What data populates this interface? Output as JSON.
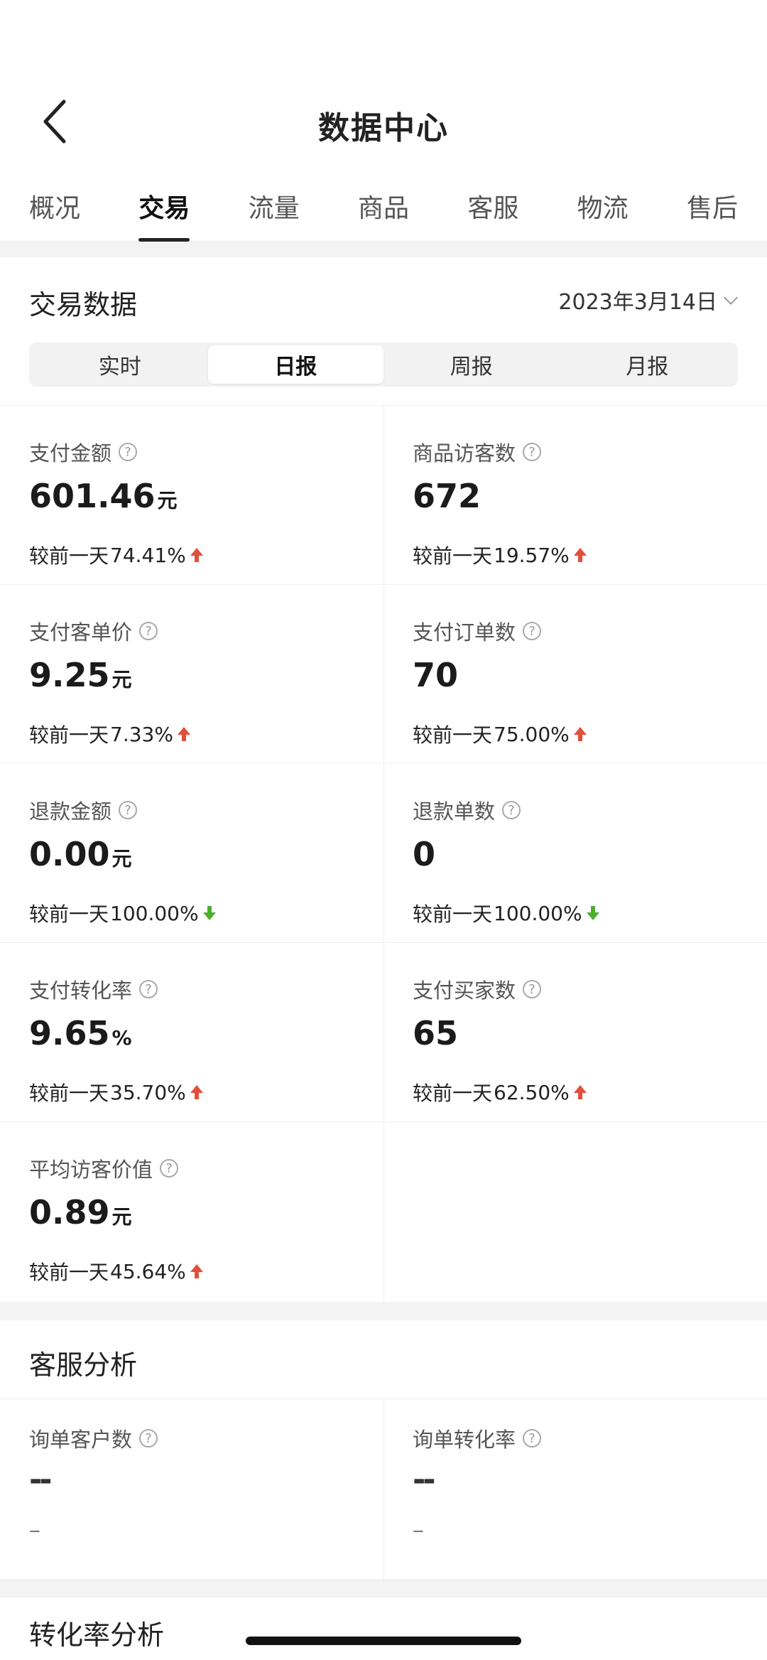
{
  "header": {
    "title": "数据中心"
  },
  "tabs": [
    "概况",
    "交易",
    "流量",
    "商品",
    "客服",
    "物流",
    "售后"
  ],
  "active_tab": "交易",
  "trade": {
    "title": "交易数据",
    "date": "2023年3月14日",
    "segments": [
      "实时",
      "日报",
      "周报",
      "月报"
    ],
    "active_segment": "日报",
    "metrics": [
      {
        "label": "支付金额",
        "value": "601.46",
        "unit": "元",
        "compare_prefix": "较前一天",
        "change": "74.41%",
        "trend": "up"
      },
      {
        "label": "商品访客数",
        "value": "672",
        "unit": "",
        "compare_prefix": "较前一天",
        "change": "19.57%",
        "trend": "up"
      },
      {
        "label": "支付客单价",
        "value": "9.25",
        "unit": "元",
        "compare_prefix": "较前一天",
        "change": "7.33%",
        "trend": "up"
      },
      {
        "label": "支付订单数",
        "value": "70",
        "unit": "",
        "compare_prefix": "较前一天",
        "change": "75.00%",
        "trend": "up"
      },
      {
        "label": "退款金额",
        "value": "0.00",
        "unit": "元",
        "compare_prefix": "较前一天",
        "change": "100.00%",
        "trend": "down"
      },
      {
        "label": "退款单数",
        "value": "0",
        "unit": "",
        "compare_prefix": "较前一天",
        "change": "100.00%",
        "trend": "down"
      },
      {
        "label": "支付转化率",
        "value": "9.65",
        "unit": "%",
        "compare_prefix": "较前一天",
        "change": "35.70%",
        "trend": "up"
      },
      {
        "label": "支付买家数",
        "value": "65",
        "unit": "",
        "compare_prefix": "较前一天",
        "change": "62.50%",
        "trend": "up"
      },
      {
        "label": "平均访客价值",
        "value": "0.89",
        "unit": "元",
        "compare_prefix": "较前一天",
        "change": "45.64%",
        "trend": "up"
      }
    ]
  },
  "service": {
    "title": "客服分析",
    "metrics": [
      {
        "label": "询单客户数",
        "value": "--",
        "compare": "--"
      },
      {
        "label": "询单转化率",
        "value": "--",
        "compare": "--"
      }
    ]
  },
  "conversion": {
    "title": "转化率分析"
  },
  "colors": {
    "up": "#e0503a",
    "down": "#4caf2e",
    "status_dot": "#f0ad4e"
  },
  "icons": {
    "help": "?",
    "back": "back-chevron-icon"
  }
}
